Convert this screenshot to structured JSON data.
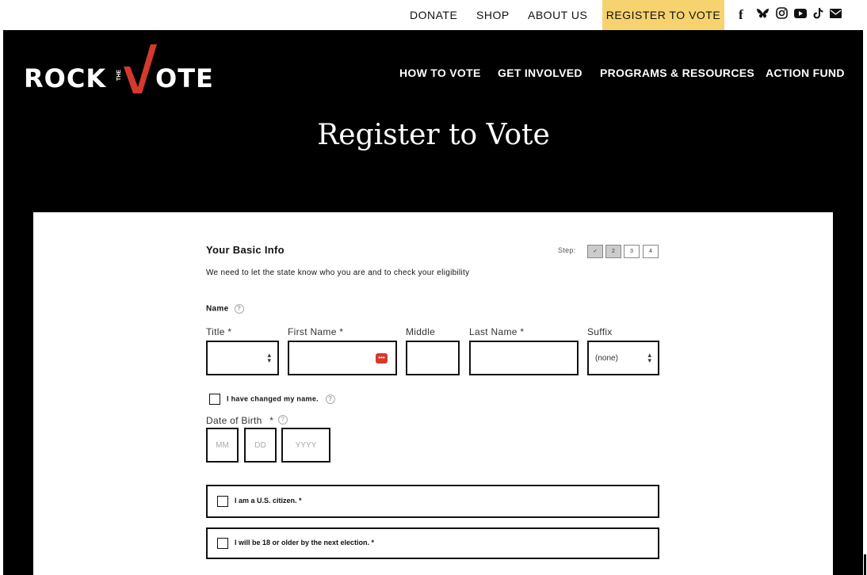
{
  "topnav": {
    "donate": "DONATE",
    "shop": "SHOP",
    "about": "ABOUT US",
    "register": "REGISTER TO VOTE"
  },
  "brand": {
    "logo_part1": "ROCK",
    "logo_the": "THE",
    "logo_part2": "OTE",
    "accent": "#d33a2c"
  },
  "mainnav": {
    "how": "HOW TO VOTE",
    "involved": "GET INVOLVED",
    "programs": "PROGRAMS & RESOURCES",
    "action": "ACTION FUND"
  },
  "page": {
    "title": "Register to Vote"
  },
  "form": {
    "section_title": "Your Basic Info",
    "section_desc": "We need to let the state know who you are and to check your eligibility",
    "step_label": "Step:",
    "steps": [
      "✓",
      "2",
      "3",
      "4"
    ],
    "name_label": "Name",
    "title_label": "Title *",
    "first_label": "First Name *",
    "middle_label": "Middle",
    "last_label": "Last Name *",
    "suffix_label": "Suffix",
    "suffix_value": "(none)",
    "changed_name": "I have changed my name.",
    "dob_label": "Date of Birth",
    "dob_req": "*",
    "mm": "MM",
    "dd": "DD",
    "yyyy": "YYYY",
    "citizen": "I am a U.S. citizen. *",
    "age": "I will be 18 or older by the next election. *"
  }
}
